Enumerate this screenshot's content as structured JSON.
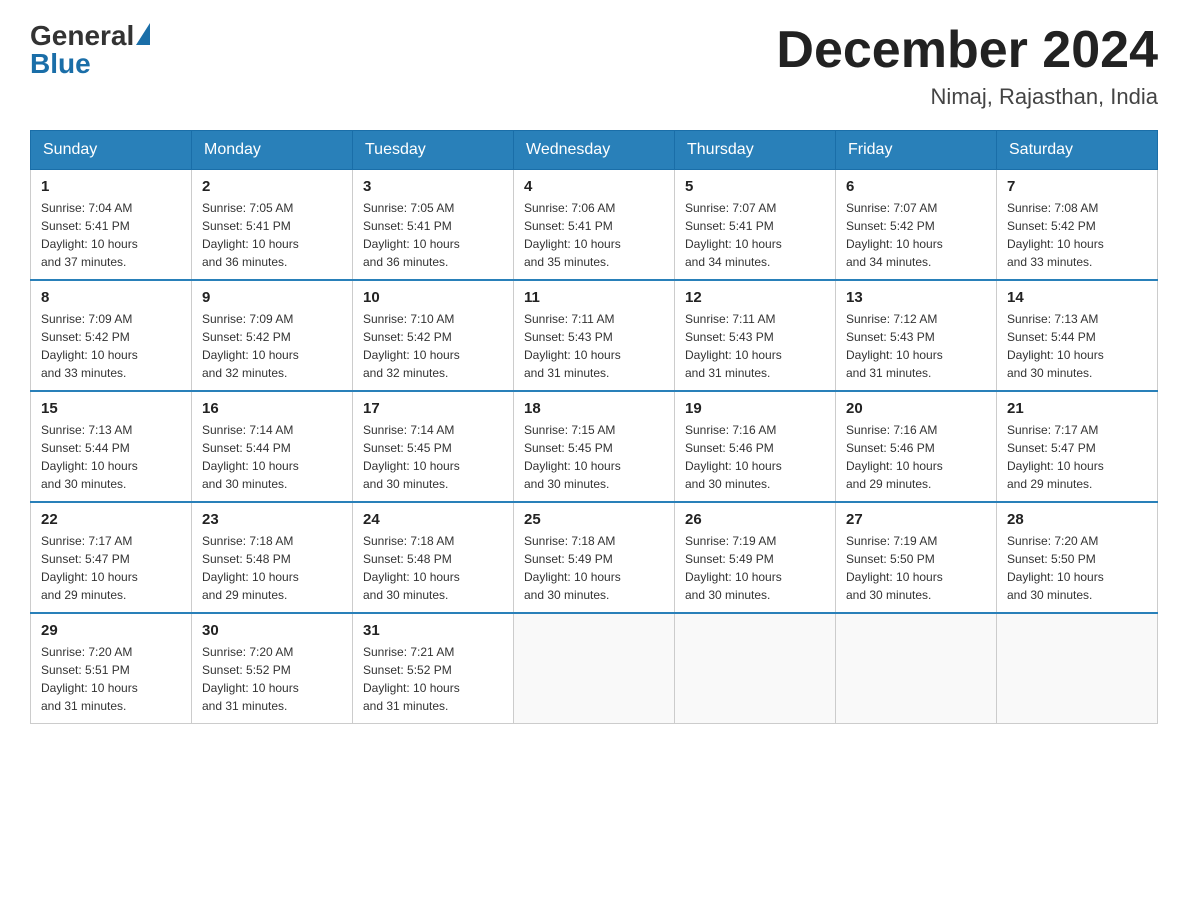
{
  "header": {
    "logo_general": "General",
    "logo_blue": "Blue",
    "month_title": "December 2024",
    "location": "Nimaj, Rajasthan, India"
  },
  "days_of_week": [
    "Sunday",
    "Monday",
    "Tuesday",
    "Wednesday",
    "Thursday",
    "Friday",
    "Saturday"
  ],
  "weeks": [
    [
      {
        "day": "1",
        "sunrise": "7:04 AM",
        "sunset": "5:41 PM",
        "daylight": "10 hours and 37 minutes."
      },
      {
        "day": "2",
        "sunrise": "7:05 AM",
        "sunset": "5:41 PM",
        "daylight": "10 hours and 36 minutes."
      },
      {
        "day": "3",
        "sunrise": "7:05 AM",
        "sunset": "5:41 PM",
        "daylight": "10 hours and 36 minutes."
      },
      {
        "day": "4",
        "sunrise": "7:06 AM",
        "sunset": "5:41 PM",
        "daylight": "10 hours and 35 minutes."
      },
      {
        "day": "5",
        "sunrise": "7:07 AM",
        "sunset": "5:41 PM",
        "daylight": "10 hours and 34 minutes."
      },
      {
        "day": "6",
        "sunrise": "7:07 AM",
        "sunset": "5:42 PM",
        "daylight": "10 hours and 34 minutes."
      },
      {
        "day": "7",
        "sunrise": "7:08 AM",
        "sunset": "5:42 PM",
        "daylight": "10 hours and 33 minutes."
      }
    ],
    [
      {
        "day": "8",
        "sunrise": "7:09 AM",
        "sunset": "5:42 PM",
        "daylight": "10 hours and 33 minutes."
      },
      {
        "day": "9",
        "sunrise": "7:09 AM",
        "sunset": "5:42 PM",
        "daylight": "10 hours and 32 minutes."
      },
      {
        "day": "10",
        "sunrise": "7:10 AM",
        "sunset": "5:42 PM",
        "daylight": "10 hours and 32 minutes."
      },
      {
        "day": "11",
        "sunrise": "7:11 AM",
        "sunset": "5:43 PM",
        "daylight": "10 hours and 31 minutes."
      },
      {
        "day": "12",
        "sunrise": "7:11 AM",
        "sunset": "5:43 PM",
        "daylight": "10 hours and 31 minutes."
      },
      {
        "day": "13",
        "sunrise": "7:12 AM",
        "sunset": "5:43 PM",
        "daylight": "10 hours and 31 minutes."
      },
      {
        "day": "14",
        "sunrise": "7:13 AM",
        "sunset": "5:44 PM",
        "daylight": "10 hours and 30 minutes."
      }
    ],
    [
      {
        "day": "15",
        "sunrise": "7:13 AM",
        "sunset": "5:44 PM",
        "daylight": "10 hours and 30 minutes."
      },
      {
        "day": "16",
        "sunrise": "7:14 AM",
        "sunset": "5:44 PM",
        "daylight": "10 hours and 30 minutes."
      },
      {
        "day": "17",
        "sunrise": "7:14 AM",
        "sunset": "5:45 PM",
        "daylight": "10 hours and 30 minutes."
      },
      {
        "day": "18",
        "sunrise": "7:15 AM",
        "sunset": "5:45 PM",
        "daylight": "10 hours and 30 minutes."
      },
      {
        "day": "19",
        "sunrise": "7:16 AM",
        "sunset": "5:46 PM",
        "daylight": "10 hours and 30 minutes."
      },
      {
        "day": "20",
        "sunrise": "7:16 AM",
        "sunset": "5:46 PM",
        "daylight": "10 hours and 29 minutes."
      },
      {
        "day": "21",
        "sunrise": "7:17 AM",
        "sunset": "5:47 PM",
        "daylight": "10 hours and 29 minutes."
      }
    ],
    [
      {
        "day": "22",
        "sunrise": "7:17 AM",
        "sunset": "5:47 PM",
        "daylight": "10 hours and 29 minutes."
      },
      {
        "day": "23",
        "sunrise": "7:18 AM",
        "sunset": "5:48 PM",
        "daylight": "10 hours and 29 minutes."
      },
      {
        "day": "24",
        "sunrise": "7:18 AM",
        "sunset": "5:48 PM",
        "daylight": "10 hours and 30 minutes."
      },
      {
        "day": "25",
        "sunrise": "7:18 AM",
        "sunset": "5:49 PM",
        "daylight": "10 hours and 30 minutes."
      },
      {
        "day": "26",
        "sunrise": "7:19 AM",
        "sunset": "5:49 PM",
        "daylight": "10 hours and 30 minutes."
      },
      {
        "day": "27",
        "sunrise": "7:19 AM",
        "sunset": "5:50 PM",
        "daylight": "10 hours and 30 minutes."
      },
      {
        "day": "28",
        "sunrise": "7:20 AM",
        "sunset": "5:50 PM",
        "daylight": "10 hours and 30 minutes."
      }
    ],
    [
      {
        "day": "29",
        "sunrise": "7:20 AM",
        "sunset": "5:51 PM",
        "daylight": "10 hours and 31 minutes."
      },
      {
        "day": "30",
        "sunrise": "7:20 AM",
        "sunset": "5:52 PM",
        "daylight": "10 hours and 31 minutes."
      },
      {
        "day": "31",
        "sunrise": "7:21 AM",
        "sunset": "5:52 PM",
        "daylight": "10 hours and 31 minutes."
      },
      null,
      null,
      null,
      null
    ]
  ],
  "labels": {
    "sunrise": "Sunrise:",
    "sunset": "Sunset:",
    "daylight": "Daylight:"
  }
}
